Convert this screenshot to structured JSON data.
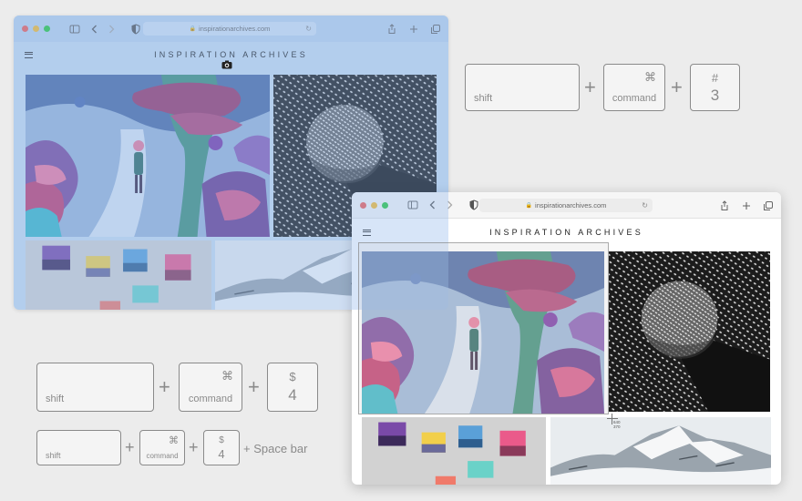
{
  "window_back": {
    "url": "inspirationarchives.com",
    "site_title": "INSPIRATION ARCHIVES",
    "icons": [
      "sidebar-icon",
      "back-icon",
      "forward-icon",
      "privacy-shield-icon",
      "lock-icon",
      "reload-icon",
      "share-icon",
      "new-tab-icon",
      "tabs-overview-icon",
      "menu-icon",
      "camera-icon"
    ]
  },
  "window_front": {
    "url": "inspirationarchives.com",
    "site_title": "INSPIRATION ARCHIVES",
    "selection_readout": {
      "w": "640",
      "h": "370"
    }
  },
  "shortcuts": {
    "full_screen": {
      "shift": "shift",
      "cmd_symbol": "⌘",
      "cmd": "command",
      "num_symbol": "#",
      "num": "3"
    },
    "selection": {
      "shift": "shift",
      "cmd_symbol": "⌘",
      "cmd": "command",
      "num_symbol": "$",
      "num": "4"
    },
    "window": {
      "shift": "shift",
      "cmd_symbol": "⌘",
      "cmd": "command",
      "num_symbol": "$",
      "num": "4",
      "extra": "+ Space bar"
    },
    "plus": "+"
  },
  "colors": {
    "overlay_tint": "#8cb4eb",
    "traffic_red": "#f25f57",
    "traffic_yellow": "#f8bc31",
    "traffic_green": "#29c840",
    "key_stroke": "#8a8a8a"
  }
}
